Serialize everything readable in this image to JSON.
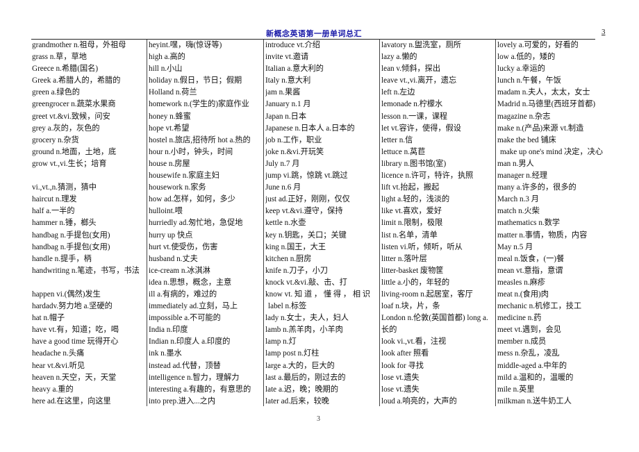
{
  "header": {
    "title": "新概念英语第一册单词总汇",
    "page_number": "3"
  },
  "footer": {
    "page_number": "3"
  },
  "columns": [
    {
      "entries": [
        "grandmother n.祖母，外祖母",
        "grass n.草，草地",
        "Greece n.希腊(国名)",
        "Greek a.希腊人的，希腊的",
        "green a.绿色的",
        "greengrocer n.蔬菜水果商",
        "greet vt.&vi.致候，问安",
        "grey a.灰的，灰色的",
        "grocery n.杂货",
        "ground n.地面，土地，底",
        "grow vt.,vi.生长；培育",
        "",
        "vi.,vt.,n.猜测，猜中",
        "haircut n.理发",
        "half a.一半的",
        "hammer n.锤，榔头",
        "handbag n.手提包(女用)",
        "handbag n.手提包(女用)",
        "handle n.提手，柄",
        "handwriting n.笔迹，书写，书法",
        "",
        "happen vi.(偶然)发生",
        "hardadv.努力地 a.坚硬的",
        "hat n.帽子",
        "have vt.有，知道；吃，喝",
        "have a good time 玩得开心",
        "headache n.头痛",
        "hear vt.&vi.听见",
        "heaven n.天空，天，天堂",
        "heavy a.重的",
        "here ad.在这里，向这里"
      ]
    },
    {
      "entries": [
        "heyint.嘿，嗨(惊讶等)",
        "high a.高的",
        "hill n.小山",
        "holiday n.假日，节日；假期",
        "Holland n.荷兰",
        "homework n.(学生的)家庭作业",
        "honey n.蜂蜜",
        "hope vt.希望",
        "hostel n.旅店,招待所 hot a.热的",
        "hour n.小时，钟头，时间",
        "house n.房屋",
        "housewife n.家庭主妇",
        "housework n.家务",
        "how ad.怎样，如何，多少",
        "hulloint.喂",
        "hurriedly ad.匆忙地，急促地",
        "hurry up 快点",
        "hurt vt.使受伤，伤害",
        "husband n.丈夫",
        "ice-cream n.冰淇淋",
        "idea n.思想，概念，主意",
        "ill a.有病的，难过的",
        "immediately ad.立刻，马上",
        "impossible a.不可能的",
        "India n.印度",
        "Indian n.印度人 a.印度的",
        "ink n.墨水",
        "instead ad.代替，顶替",
        "intelligence n.智力，理解力",
        "interesting a.有趣的，有意思的",
        "into prep.进入...之内"
      ]
    },
    {
      "entries": [
        "introduce vt.介绍",
        "invite vt.邀请",
        "Italian a.意大利的",
        "Italy n.意大利",
        "jam n.果酱",
        "January n.1 月",
        "Japan n.日本",
        "Japanese n.日本人 a.日本的",
        "job n.工作，职业",
        "joke n.&vi.开玩笑",
        "July n.7 月",
        "jump vi.跳，惊跳 vt.跳过",
        "June n.6 月",
        "just ad.正好，刚刚，仅仅",
        "keep vt.&vi.遵守，保持",
        "kettle n.水壶",
        "key n.钥匙，关口；关键",
        "king n.国王，大王",
        "kitchen n.厨房",
        "knife n.刀子，小刀",
        "knock vt.&vi.敲、击、打",
        "know vt. 知 道 ， 懂 得 ， 相 识",
        " label n.标签",
        "lady n.女士，夫人，妇人",
        "lamb n.羔羊肉，小羊肉",
        "lamp n.灯",
        "lamp post n.灯柱",
        "large a.大的，巨大的",
        "last a.最后的，刚过去的",
        "late a.迟，晚；晚期的",
        "later ad.后来，较晚"
      ]
    },
    {
      "entries": [
        "lavatory n.盥洗室，厕所",
        "lazy a.懒的",
        "lean v.倾斜，探出",
        "leave vt.,vi.离开，遗忘",
        "left n.左边",
        "lemonade n.柠檬水",
        "lesson n.一课，课程",
        "let vt.容许，使得，假设",
        "letter n.信",
        "lettuce n.莴苣",
        "library n.图书馆(室)",
        "licence n.许可，特许，执照",
        "lift vt.抬起，搬起",
        "light a.轻的，浅淡的",
        "like vt.喜欢，爱好",
        "limit n.限制，极限",
        "list n.名单，清单",
        "listen vi.听，倾听，听从",
        "litter n.落叶层",
        "litter-basket 废物筐",
        "little a.小的，年轻的",
        "living-room n.起居室，客厅",
        "loaf n.块，片，条",
        "London n.伦敦(英国首都) long a.",
        "长的",
        "look vi.,vt.看，注视",
        "look after 照看",
        "look for 寻找",
        "lose vt.遗失",
        "lose vt.遗失",
        "loud a.响亮的，大声的"
      ]
    },
    {
      "entries": [
        "lovely a.可爱的，好看的",
        "low a.低的，矮的",
        "lucky a.幸运的",
        "lunch n.午餐，午饭",
        "madam n.夫人，太太，女士",
        "Madrid n.马德里(西班牙首都)",
        "magazine n.杂志",
        "make n.(产品)来源 vt.制造",
        "make the bed 铺床",
        " make up one's mind 决定，决心",
        "man n.男人",
        "manager n.经理",
        "many a.许多的，很多的",
        "March n.3 月",
        "match n.火柴",
        "mathematics n.数学",
        "matter n.事情，物质，内容",
        "May n.5 月",
        "meal n.饭食，(一)餐",
        "mean vt.意指，意谓",
        "measles n.麻疹",
        "meat n.(食用)肉",
        "mechanic n.机修工，技工",
        "medicine n.药",
        "meet vt.遇到，会见",
        "member n.成员",
        "mess n.杂乱，凌乱",
        "middle-aged a.中年的",
        "mild a.温和的，温暖的",
        "mile n.英里",
        "milkman n.送牛奶工人"
      ]
    }
  ]
}
